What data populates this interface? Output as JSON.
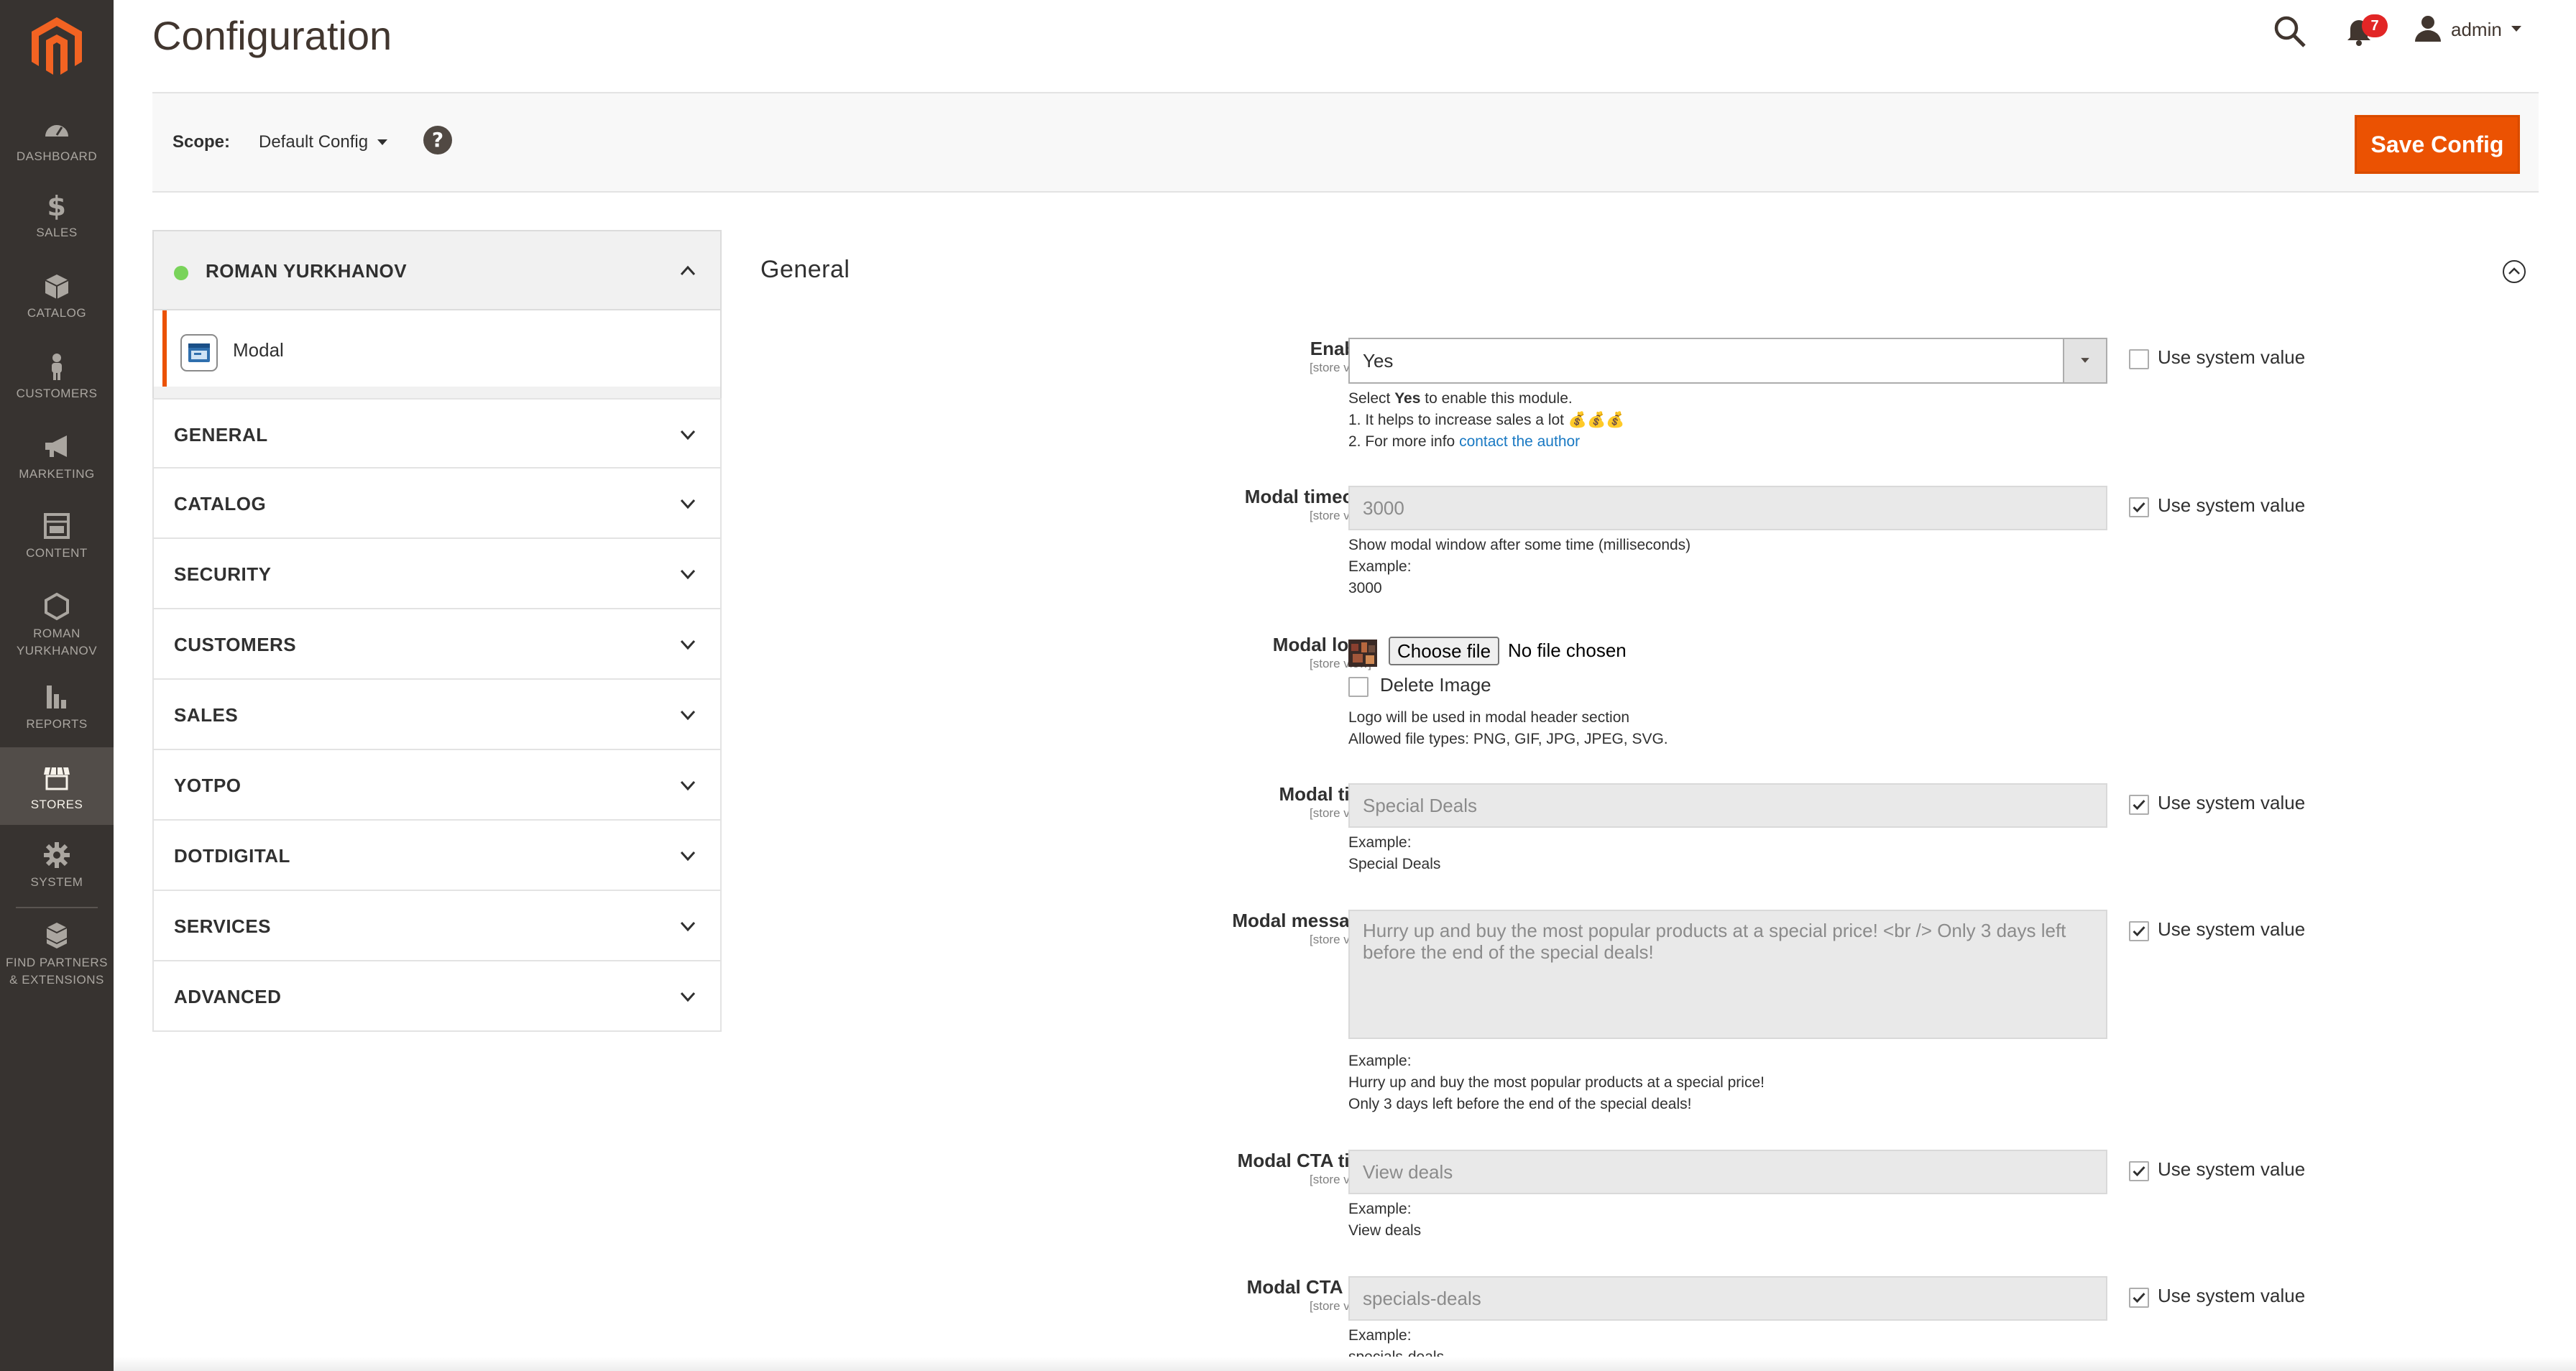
{
  "nav": {
    "items": [
      {
        "label": "DASHBOARD",
        "icon": "dashboard-icon"
      },
      {
        "label": "SALES",
        "icon": "dollar-icon"
      },
      {
        "label": "CATALOG",
        "icon": "box-icon"
      },
      {
        "label": "CUSTOMERS",
        "icon": "person-icon"
      },
      {
        "label": "MARKETING",
        "icon": "megaphone-icon"
      },
      {
        "label": "CONTENT",
        "icon": "layout-icon"
      },
      {
        "label": "ROMAN\nYURKHANOV",
        "icon": "hexagon-icon"
      },
      {
        "label": "REPORTS",
        "icon": "bar-chart-icon"
      },
      {
        "label": "STORES",
        "icon": "storefront-icon"
      },
      {
        "label": "SYSTEM",
        "icon": "gear-icon"
      },
      {
        "label": "FIND PARTNERS\n& EXTENSIONS",
        "icon": "cubes-icon"
      }
    ],
    "active": "STORES"
  },
  "header": {
    "title": "Configuration",
    "notifications_count": "7",
    "user": "admin"
  },
  "scope": {
    "label": "Scope:",
    "value": "Default Config",
    "save_label": "Save Config"
  },
  "tabs": {
    "group_title": "ROMAN YURKHANOV",
    "sub_item": "Modal",
    "sections": [
      "GENERAL",
      "CATALOG",
      "SECURITY",
      "CUSTOMERS",
      "SALES",
      "YOTPO",
      "DOTDIGITAL",
      "SERVICES",
      "ADVANCED"
    ]
  },
  "config": {
    "section_title": "General",
    "scope_hint": "[store view]",
    "use_system_value": "Use system value",
    "enable": {
      "label": "Enable",
      "value": "Yes",
      "note_pre": "Select ",
      "note_bold": "Yes",
      "note_post": " to enable this module.",
      "note_line2": "1. It helps to increase sales a lot 💰💰💰",
      "note_line3_pre": "2. For more info ",
      "note_link": "contact the author"
    },
    "timeout": {
      "label": "Modal timeout",
      "value": "3000",
      "note1": "Show modal window after some time (milliseconds)",
      "note2": "Example:",
      "note3": "3000"
    },
    "logo": {
      "label": "Modal logo",
      "button": "Choose file",
      "file_text": "No file chosen",
      "delete_label": "Delete Image",
      "note1": "Logo will be used in modal header section",
      "note2": "Allowed file types: PNG, GIF, JPG, JPEG, SVG."
    },
    "title": {
      "label": "Modal title",
      "value": "Special Deals",
      "note1": "Example:",
      "note2": "Special Deals"
    },
    "message": {
      "label": "Modal message",
      "value": "Hurry up and buy the most popular products at a special price! <br /> Only 3 days left before the end of the special deals!",
      "note1": "Example:",
      "note2": "Hurry up and buy the most popular products at a special price!",
      "note3": "Only 3 days left before the end of the special deals!"
    },
    "cta_title": {
      "label": "Modal CTA title",
      "value": "View deals",
      "note1": "Example:",
      "note2": "View deals"
    },
    "cta_url": {
      "label": "Modal CTA url",
      "value": "specials-deals",
      "note1": "Example:",
      "note2": "specials-deals"
    }
  },
  "colors": {
    "nav_bg": "#373330",
    "accent": "#eb5202",
    "link": "#1979c3",
    "badge": "#e22626",
    "status_dot": "#79d35a"
  }
}
